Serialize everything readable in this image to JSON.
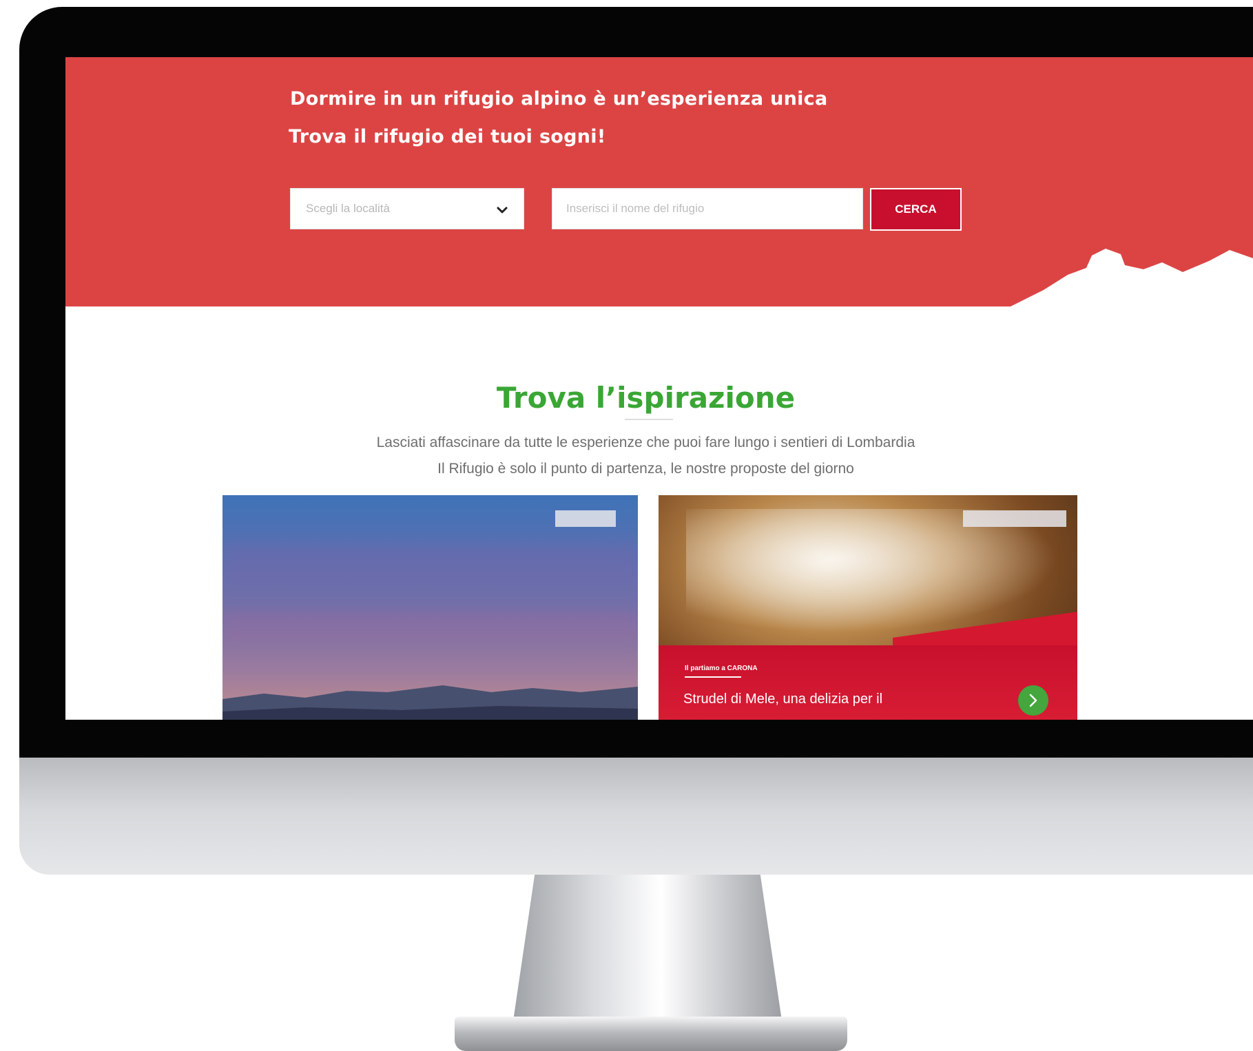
{
  "hero": {
    "headline": "Dormire in un rifugio alpino è un’esperienza unica",
    "subline": "Trova il rifugio dei tuoi sogni!",
    "location_select": {
      "value": "Scegli la località"
    },
    "search": {
      "placeholder": "Inserisci il nome del rifugio"
    },
    "search_button_label": "CERCA",
    "background_color": "#dc4444"
  },
  "inspiration": {
    "title": "Trova l’ispirazione",
    "intro_line_1": "Lasciati affascinare da tutte le esperienze che puoi fare lungo i sentieri di Lombardia",
    "intro_line_2": "Il Rifugio è solo il punto di partenza, le nostre proposte del giorno",
    "title_color": "#3aa635"
  },
  "cards": [
    {
      "image": "mountain-sunset-photo"
    },
    {
      "image": "apple-strudel-photo",
      "kicker": "Il partiamo a CARONA",
      "title": "Strudel di Mele, una delizia per il",
      "accent_color": "#c8102e",
      "action_icon": "chevron-right-icon"
    }
  ]
}
